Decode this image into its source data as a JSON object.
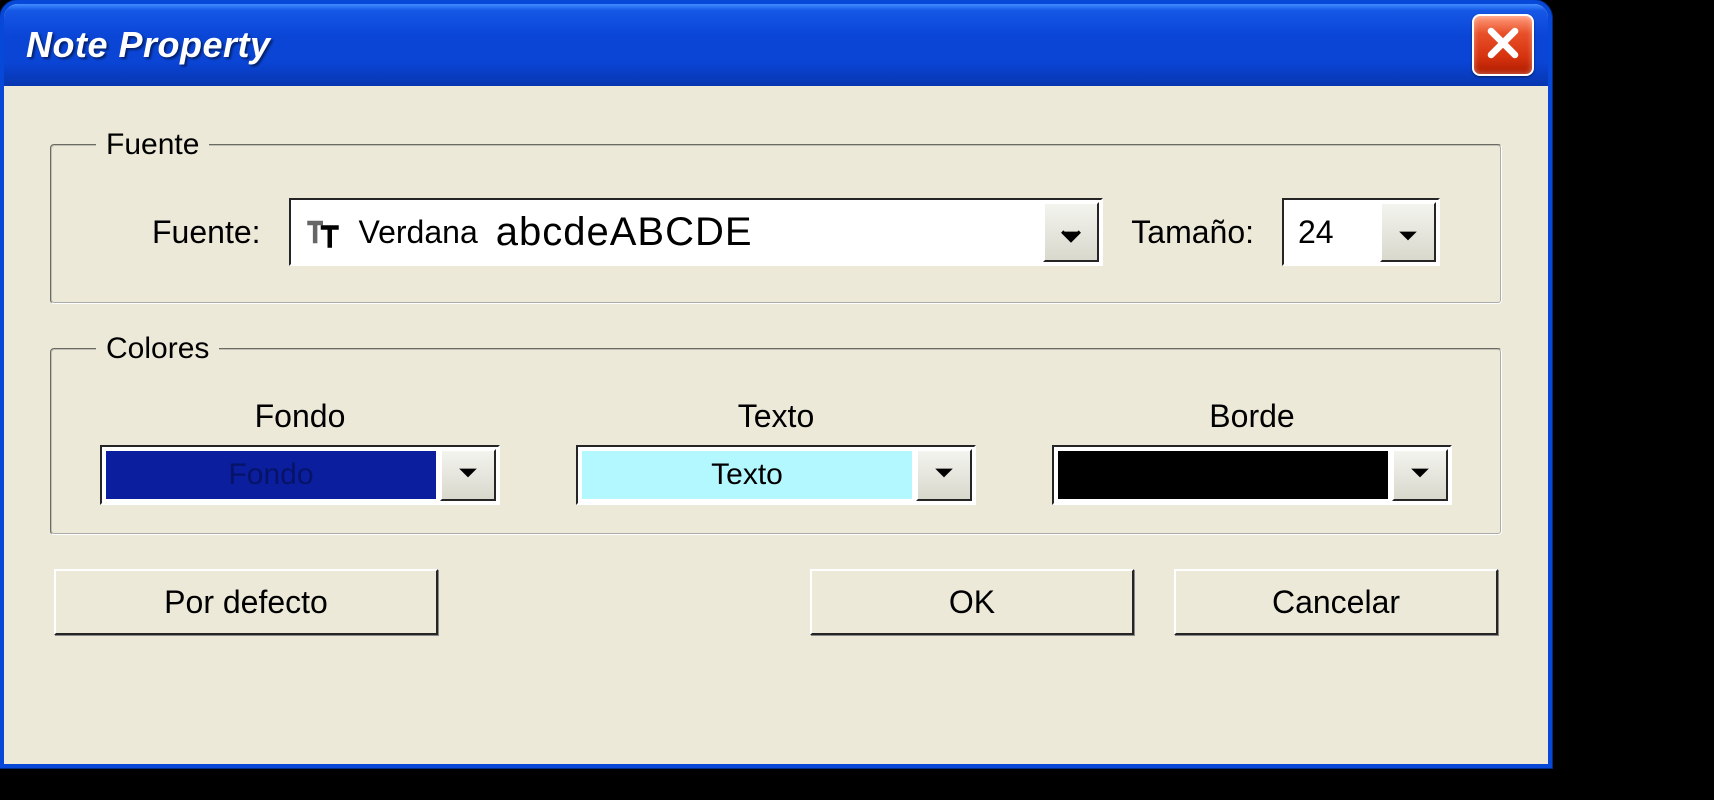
{
  "window": {
    "title": "Note Property"
  },
  "fuente_group": {
    "legend": "Fuente",
    "font_label": "Fuente:",
    "font_name": "Verdana",
    "font_sample": "abcdeABCDE",
    "size_label": "Tamaño:",
    "size_value": "24"
  },
  "colores_group": {
    "legend": "Colores",
    "fondo": {
      "label": "Fondo",
      "swatch_text": "Fondo",
      "color": "#0a1e9e"
    },
    "texto": {
      "label": "Texto",
      "swatch_text": "Texto",
      "color": "#b4f8ff"
    },
    "borde": {
      "label": "Borde",
      "swatch_text": "",
      "color": "#000000"
    }
  },
  "buttons": {
    "default": "Por defecto",
    "ok": "OK",
    "cancel": "Cancelar"
  }
}
